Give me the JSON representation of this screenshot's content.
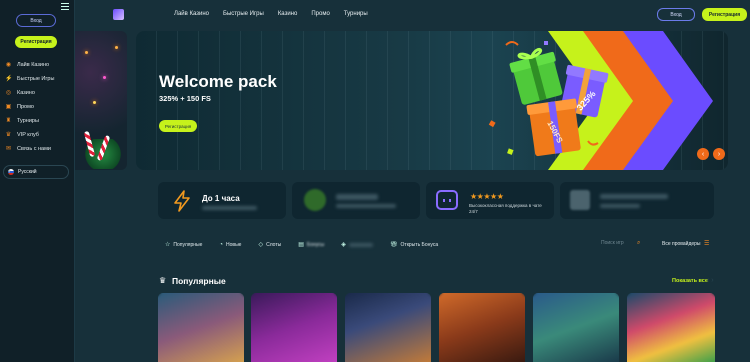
{
  "sidebar": {
    "login_label": "Вход",
    "register_label": "Регистрация",
    "items": [
      {
        "icon": "live-icon",
        "label": "Лайв Казино"
      },
      {
        "icon": "quick-games-icon",
        "label": "Быстрые Игры"
      },
      {
        "icon": "casino-icon",
        "label": "Казино"
      },
      {
        "icon": "promo-icon",
        "label": "Промо"
      },
      {
        "icon": "tournament-icon",
        "label": "Турниры"
      },
      {
        "icon": "vip-icon",
        "label": "VIP клуб"
      },
      {
        "icon": "support-icon",
        "label": "Связь с нами"
      }
    ],
    "language": "Русский"
  },
  "header": {
    "nav": [
      "Лайв Казино",
      "Быстрые Игры",
      "Казино",
      "Промо",
      "Турниры"
    ],
    "login_label": "Вход",
    "register_label": "Регистрация"
  },
  "banner": {
    "title": "Welcome pack",
    "subtitle": "325% + 150 FS",
    "button_label": "Регистрация",
    "gift_labels": [
      "325%",
      "150FS"
    ]
  },
  "features": {
    "speed_title": "До 1 часа",
    "support_text": "Высококлассная поддержка в чате 24/7",
    "rating_stars": 4.5
  },
  "categories": [
    {
      "icon": "star-icon",
      "label": "Популярные"
    },
    {
      "icon": "new-icon",
      "label": "Новые"
    },
    {
      "icon": "diamond-icon",
      "label": "Слоты"
    },
    {
      "icon": "bonus-icon",
      "label": "Бонусы"
    },
    {
      "icon": "card-icon",
      "label": ""
    },
    {
      "icon": "gift-icon",
      "label": "Открыть Бонуса"
    }
  ],
  "search_placeholder": "Поиск игр",
  "providers_label": "Все провайдеры",
  "popular": {
    "title": "Популярные",
    "show_all": "Показать все"
  },
  "colors": {
    "accent": "#c6f21b",
    "orange": "#f06a1a",
    "purple": "#6b4cff",
    "bg": "#17303a"
  }
}
